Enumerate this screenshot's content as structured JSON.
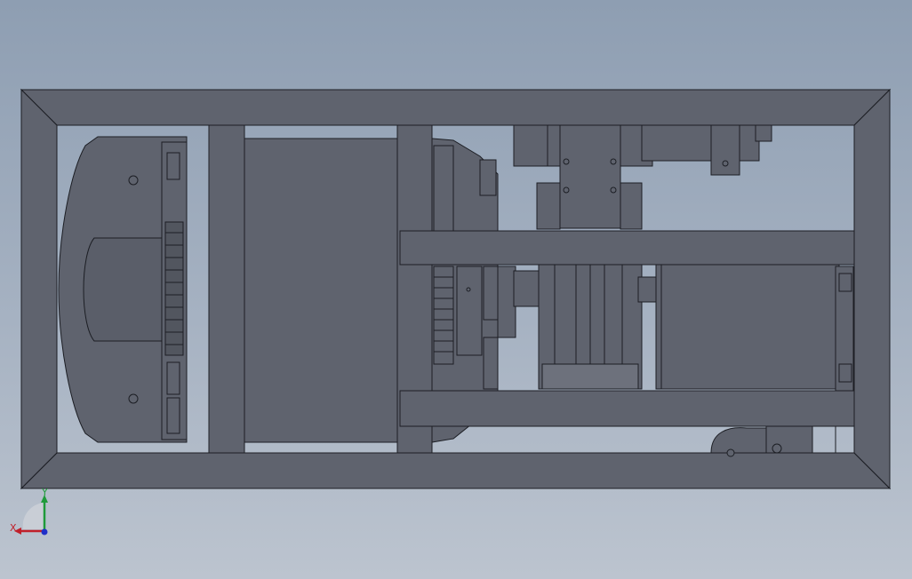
{
  "viewport": {
    "background_top": "#8e9eb2",
    "background_bottom": "#bcc4cf",
    "part_color": "#5f636e",
    "edge_color": "#1c1e24"
  },
  "triad": {
    "x_label": "X",
    "y_label": "Y",
    "x_color": "#c0202a",
    "y_color": "#1f9a3a",
    "z_color": "#2030c8"
  }
}
